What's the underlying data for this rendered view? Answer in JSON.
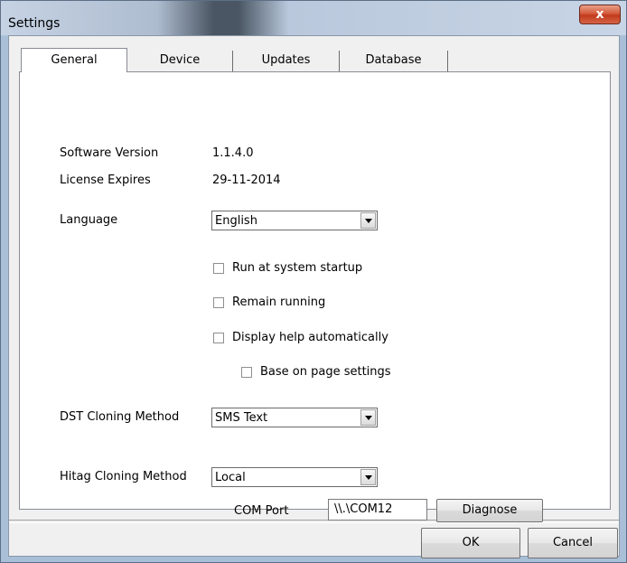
{
  "window": {
    "title": "Settings",
    "close_glyph": "x"
  },
  "tabs": [
    {
      "label": "General",
      "active": true
    },
    {
      "label": "Device",
      "active": false
    },
    {
      "label": "Updates",
      "active": false
    },
    {
      "label": "Database",
      "active": false
    }
  ],
  "general": {
    "software_version_label": "Software Version",
    "software_version_value": "1.1.4.0",
    "license_expires_label": "License Expires",
    "license_expires_value": "29-11-2014",
    "language_label": "Language",
    "language_value": "English",
    "checkboxes": {
      "run_at_startup": "Run at system startup",
      "remain_running": "Remain running",
      "display_help": "Display help automatically",
      "base_on_page": "Base on page settings"
    },
    "dst_label": "DST Cloning Method",
    "dst_value": "SMS Text",
    "hitag_label": "Hitag Cloning Method",
    "hitag_value": "Local",
    "com_port_label": "COM Port",
    "com_port_value": "\\\\.\\COM12",
    "diagnose_label": "Diagnose"
  },
  "footer": {
    "ok_label": "OK",
    "cancel_label": "Cancel"
  },
  "icons": {
    "close": "close-icon",
    "dropdown": "chevron-down-icon"
  }
}
